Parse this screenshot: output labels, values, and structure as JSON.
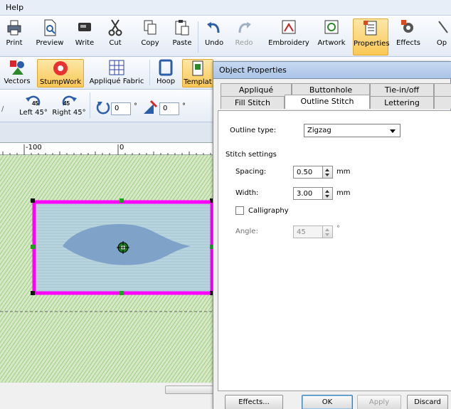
{
  "menu": {
    "help": "Help"
  },
  "toolbar": {
    "print": "Print",
    "preview": "Preview",
    "write": "Write",
    "cut": "Cut",
    "copy": "Copy",
    "paste": "Paste",
    "undo": "Undo",
    "redo": "Redo",
    "embroidery": "Embroidery",
    "artwork": "Artwork",
    "properties": "Properties",
    "effects": "Effects",
    "options_partial": "Op"
  },
  "toolbar2": {
    "vectors": "Vectors",
    "stumpwork": "StumpWork",
    "applique_fabric": "Appliqué Fabric",
    "hoop": "Hoop",
    "template": "Templat"
  },
  "rotate": {
    "left_label": "Left 45°",
    "right_label": "Right 45°",
    "left_badge": "45",
    "right_badge": "45",
    "angle_value": "0",
    "slant_value": "0",
    "deg": "°"
  },
  "ruler": {
    "m100": "-100",
    "zero": "0"
  },
  "dialog": {
    "title": "Object Properties",
    "tabs_row1": [
      "Appliqué",
      "Buttonhole",
      "Tie-in/off"
    ],
    "tabs_row2": [
      "Fill Stitch",
      "Outline Stitch",
      "Lettering"
    ],
    "outline_type_label": "Outline type:",
    "outline_type_value": "Zigzag",
    "stitch_settings": "Stitch settings",
    "spacing_label": "Spacing:",
    "spacing_value": "0.50",
    "width_label": "Width:",
    "width_value": "3.00",
    "unit_mm": "mm",
    "calligraphy": "Calligraphy",
    "angle_label": "Angle:",
    "angle_value": "45",
    "angle_unit": "°",
    "buttons": {
      "effects": "Effects...",
      "ok": "OK",
      "apply": "Apply",
      "discard": "Discard"
    }
  },
  "colors": {
    "selection": "#ff00ff",
    "leaf": "#7fa3c8",
    "stitch_green": "#a7d38a",
    "handle": "#19a319"
  }
}
